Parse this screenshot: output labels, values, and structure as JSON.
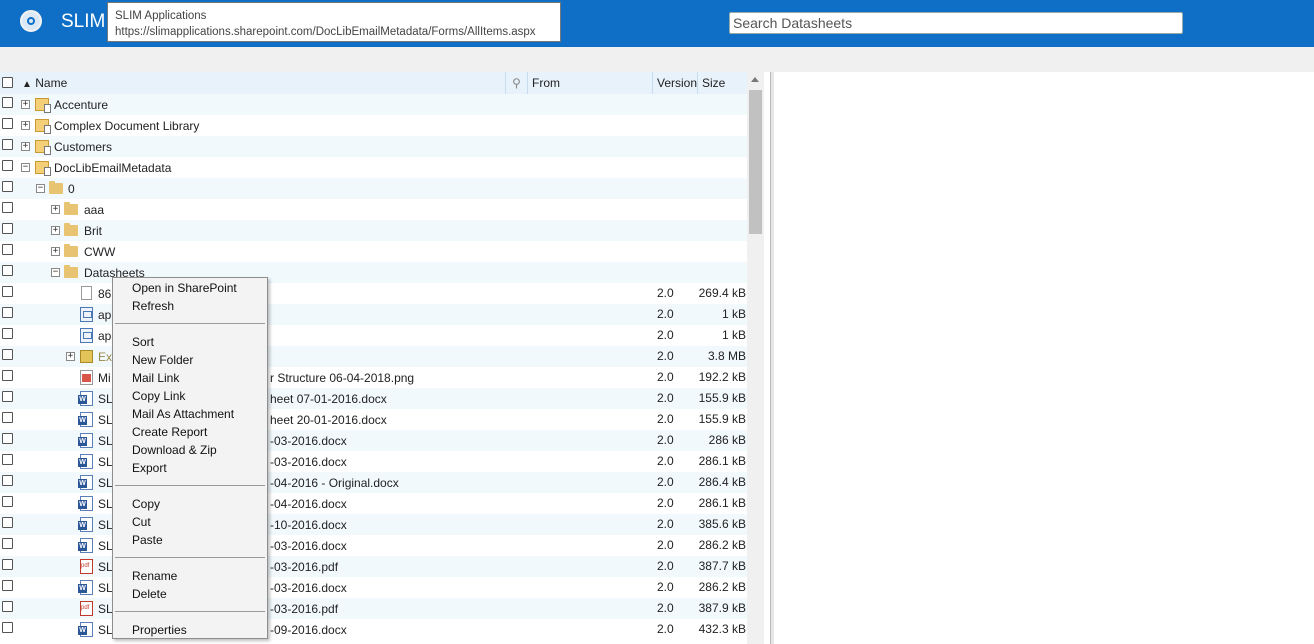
{
  "header": {
    "brand": "SLIM",
    "tooltip_title": "SLIM Applications",
    "tooltip_url": "https://slimapplications.sharepoint.com/DocLibEmailMetadata/Forms/AllItems.aspx",
    "search_placeholder": "Search Datasheets",
    "accent_color": "#0f6fc6"
  },
  "columns": {
    "sort_indicator": "▲",
    "name": "Name",
    "attach_icon": "paperclip-icon",
    "from": "From",
    "version": "Version",
    "size": "Size"
  },
  "rows": [
    {
      "name": "Accenture",
      "version": "",
      "size": ""
    },
    {
      "name": "Complex Document Library",
      "version": "",
      "size": ""
    },
    {
      "name": "Customers",
      "version": "",
      "size": ""
    },
    {
      "name": "DocLibEmailMetadata",
      "version": "",
      "size": ""
    },
    {
      "name": "0",
      "version": "",
      "size": ""
    },
    {
      "name": "aaa",
      "version": "",
      "size": ""
    },
    {
      "name": "Brit",
      "version": "",
      "size": ""
    },
    {
      "name": "CWW",
      "version": "",
      "size": ""
    },
    {
      "name": "Datasheets",
      "version": "",
      "size": ""
    },
    {
      "name": "86",
      "version": "2.0",
      "size": "269.4 kB"
    },
    {
      "name": "ap",
      "version": "2.0",
      "size": "1 kB"
    },
    {
      "name": "ap",
      "version": "2.0",
      "size": "1 kB"
    },
    {
      "name": "Ex",
      "version": "2.0",
      "size": "3.8 MB"
    },
    {
      "name": "Mi",
      "version": "2.0",
      "size": "192.2 kB"
    },
    {
      "name": "SL",
      "version": "2.0",
      "size": "155.9 kB"
    },
    {
      "name": "SL",
      "version": "2.0",
      "size": "155.9 kB"
    },
    {
      "name": "SL",
      "version": "2.0",
      "size": "286 kB"
    },
    {
      "name": "SL",
      "version": "2.0",
      "size": "286.1 kB"
    },
    {
      "name": "SL",
      "version": "2.0",
      "size": "286.4 kB"
    },
    {
      "name": "SL",
      "version": "2.0",
      "size": "286.1 kB"
    },
    {
      "name": "SL",
      "version": "2.0",
      "size": "385.6 kB"
    },
    {
      "name": "SL",
      "version": "2.0",
      "size": "286.2 kB"
    },
    {
      "name": "SL",
      "version": "2.0",
      "size": "387.7 kB"
    },
    {
      "name": "SL",
      "version": "2.0",
      "size": "286.2 kB"
    },
    {
      "name": "SL",
      "version": "2.0",
      "size": "387.9 kB"
    },
    {
      "name": "SL",
      "version": "2.0",
      "size": "432.3 kB"
    }
  ],
  "name_tails": [
    "r Structure 06-04-2018.png",
    "heet 07-01-2016.docx",
    "heet 20-01-2016.docx",
    "-03-2016.docx",
    "-03-2016.docx",
    "-04-2016 - Original.docx",
    "-04-2016.docx",
    "-10-2016.docx",
    "-03-2016.docx",
    "-03-2016.pdf",
    "-03-2016.docx",
    "-03-2016.pdf",
    "-09-2016.docx"
  ],
  "context_menu": {
    "open_in_sharepoint": "Open in SharePoint",
    "refresh": "Refresh",
    "sort": "Sort",
    "new_folder": "New Folder",
    "mail_link": "Mail Link",
    "copy_link": "Copy Link",
    "mail_as_attachment": "Mail As Attachment",
    "create_report": "Create Report",
    "download_zip": "Download & Zip",
    "export": "Export",
    "copy": "Copy",
    "cut": "Cut",
    "paste": "Paste",
    "rename": "Rename",
    "delete": "Delete",
    "properties": "Properties"
  }
}
